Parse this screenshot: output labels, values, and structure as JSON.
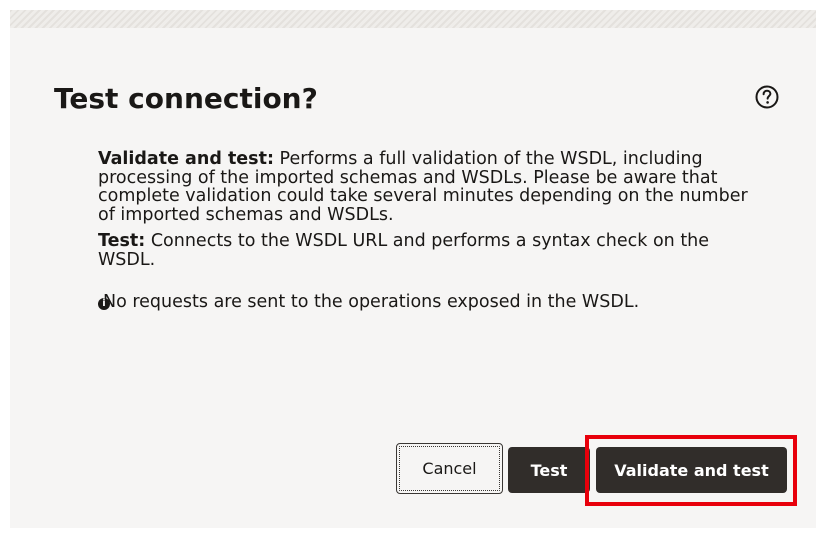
{
  "dialog": {
    "title": "Test connection?",
    "help_icon": "question-circle-icon",
    "paragraphs": [
      {
        "label": "Validate and test:",
        "text": " Performs a full validation of the WSDL, including processing of the imported schemas and WSDLs. Please be aware that complete validation could take several minutes depending on the number of imported schemas and WSDLs."
      },
      {
        "label": "Test:",
        "text": " Connects to the WSDL URL and performs a syntax check on the WSDL."
      }
    ],
    "note": {
      "icon": "info-icon",
      "text": "No requests are sent to the operations exposed in the WSDL."
    }
  },
  "buttons": {
    "cancel": "Cancel",
    "test": "Test",
    "validate": "Validate and test"
  },
  "colors": {
    "button_dark": "#312d2a",
    "highlight": "#e8000b",
    "background": "#f6f5f4"
  }
}
